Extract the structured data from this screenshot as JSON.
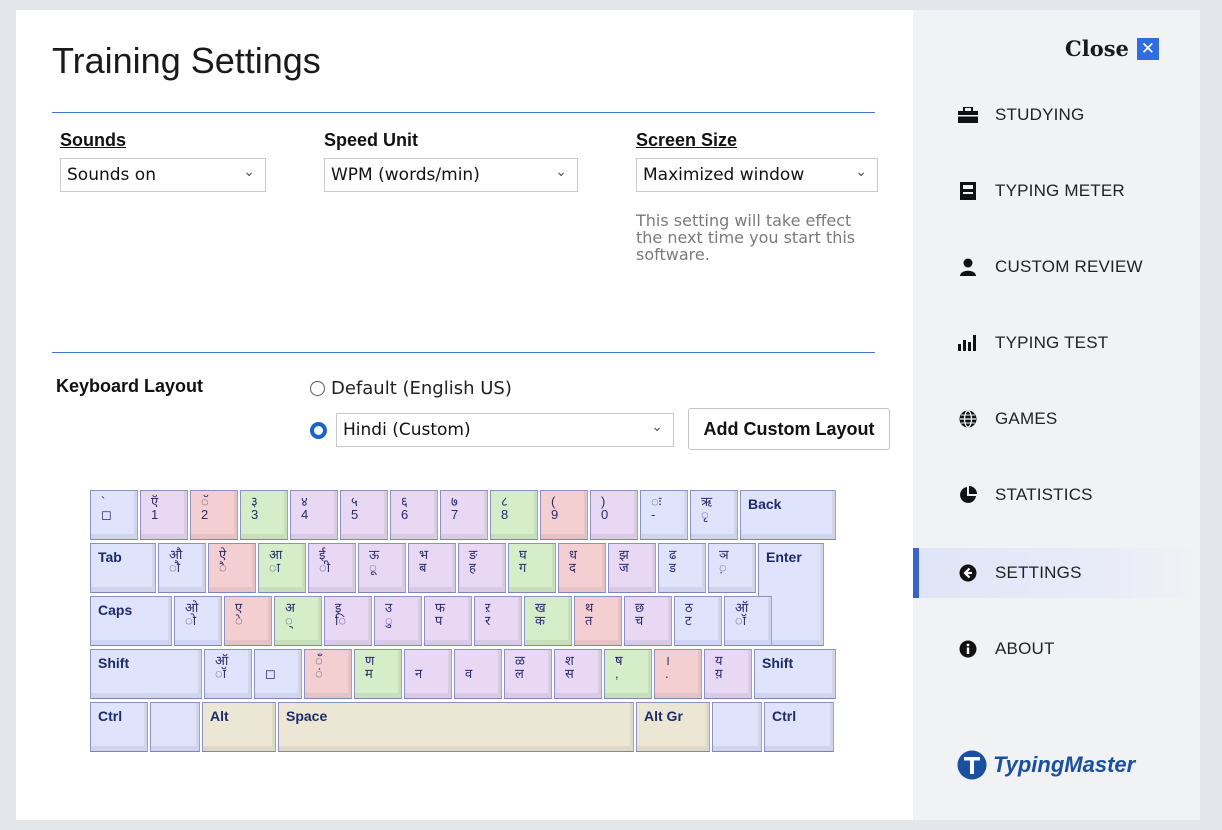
{
  "title": "Training Settings",
  "sounds": {
    "label": "Sounds",
    "value": "Sounds on"
  },
  "speed_unit": {
    "label": "Speed Unit",
    "value": "WPM (words/min)"
  },
  "screen_size": {
    "label": "Screen Size",
    "value": "Maximized window",
    "note": "This setting will take effect the next time you start this software."
  },
  "keyboard_layout": {
    "label": "Keyboard Layout",
    "option_default": "Default (English US)",
    "option_custom": "Hindi (Custom)",
    "add_button": "Add Custom Layout"
  },
  "keyboard": {
    "rows": [
      {
        "keys": [
          {
            "t": "`",
            "b": "◻",
            "c": "blue"
          },
          {
            "t": "ऍ",
            "b": "1",
            "c": "lav"
          },
          {
            "t": "ॅ",
            "b": "2",
            "c": "pink"
          },
          {
            "t": "३",
            "b": "3",
            "c": "green"
          },
          {
            "t": "४",
            "b": "4",
            "c": "lav"
          },
          {
            "t": "५",
            "b": "5",
            "c": "lav"
          },
          {
            "t": "६",
            "b": "6",
            "c": "lav"
          },
          {
            "t": "७",
            "b": "7",
            "c": "lav"
          },
          {
            "t": "८",
            "b": "8",
            "c": "green"
          },
          {
            "t": "(",
            "b": "9",
            "c": "pink"
          },
          {
            "t": ")",
            "b": "0",
            "c": "lav"
          },
          {
            "t": "ः",
            "b": "-",
            "c": "blue"
          },
          {
            "t": "ऋ",
            "b": "ृ",
            "c": "blue"
          },
          {
            "f": "Back",
            "c": "blue"
          }
        ]
      },
      {
        "keys": [
          {
            "f": "Tab",
            "c": "blue"
          },
          {
            "t": "औ",
            "b": "ौ",
            "c": "blue"
          },
          {
            "t": "ऐ",
            "b": "ै",
            "c": "pink"
          },
          {
            "t": "आ",
            "b": "ा",
            "c": "green"
          },
          {
            "t": "ई",
            "b": "ी",
            "c": "lav"
          },
          {
            "t": "ऊ",
            "b": "ू",
            "c": "lav"
          },
          {
            "t": "भ",
            "b": "ब",
            "c": "lav"
          },
          {
            "t": "ङ",
            "b": "ह",
            "c": "lav"
          },
          {
            "t": "घ",
            "b": "ग",
            "c": "green"
          },
          {
            "t": "ध",
            "b": "द",
            "c": "pink"
          },
          {
            "t": "झ",
            "b": "ज",
            "c": "lav"
          },
          {
            "t": "ढ",
            "b": "ड",
            "c": "blue"
          },
          {
            "t": "ञ",
            "b": "़",
            "c": "blue"
          },
          {
            "f": "Enter",
            "c": "blue"
          }
        ]
      },
      {
        "keys": [
          {
            "f": "Caps",
            "c": "blue"
          },
          {
            "t": "ओ",
            "b": "ो",
            "c": "blue"
          },
          {
            "t": "ए",
            "b": "े",
            "c": "pink"
          },
          {
            "t": "अ",
            "b": "्",
            "c": "green"
          },
          {
            "t": "इ",
            "b": "ि",
            "c": "lav"
          },
          {
            "t": "उ",
            "b": "ु",
            "c": "lav"
          },
          {
            "t": "फ",
            "b": "प",
            "c": "lav"
          },
          {
            "t": "ऱ",
            "b": "र",
            "c": "lav"
          },
          {
            "t": "ख",
            "b": "क",
            "c": "green"
          },
          {
            "t": "थ",
            "b": "त",
            "c": "pink"
          },
          {
            "t": "छ",
            "b": "च",
            "c": "lav"
          },
          {
            "t": "ठ",
            "b": "ट",
            "c": "blue"
          },
          {
            "t": "ऑ",
            "b": "ॉ",
            "c": "blue"
          }
        ]
      },
      {
        "keys": [
          {
            "f": "Shift",
            "c": "blue"
          },
          {
            "t": "ऑ",
            "b": "ॉ",
            "c": "blue"
          },
          {
            "t": "",
            "b": "◻",
            "c": "blue"
          },
          {
            "t": "ँ",
            "b": "ं",
            "c": "pink"
          },
          {
            "t": "ण",
            "b": "म",
            "c": "green"
          },
          {
            "t": "",
            "b": "न",
            "c": "lav"
          },
          {
            "t": "",
            "b": "व",
            "c": "lav"
          },
          {
            "t": "ळ",
            "b": "ल",
            "c": "lav"
          },
          {
            "t": "श",
            "b": "स",
            "c": "lav"
          },
          {
            "t": "ष",
            "b": ",",
            "c": "green"
          },
          {
            "t": "।",
            "b": ".",
            "c": "pink"
          },
          {
            "t": "य",
            "b": "य़",
            "c": "lav"
          },
          {
            "f": "Shift",
            "c": "blue"
          }
        ]
      },
      {
        "keys": [
          {
            "f": "Ctrl",
            "c": "blue"
          },
          {
            "f": "",
            "c": "blue"
          },
          {
            "f": "Alt",
            "c": "beige"
          },
          {
            "f": "Space",
            "c": "beige"
          },
          {
            "f": "Alt Gr",
            "c": "beige"
          },
          {
            "f": "",
            "c": "blue"
          },
          {
            "f": "Ctrl",
            "c": "blue"
          }
        ]
      }
    ]
  },
  "sidebar": {
    "close_label": "Close",
    "items": [
      {
        "label": "STUDYING",
        "icon": "briefcase-icon"
      },
      {
        "label": "TYPING METER",
        "icon": "meter-icon"
      },
      {
        "label": "CUSTOM REVIEW",
        "icon": "person-icon"
      },
      {
        "label": "TYPING TEST",
        "icon": "bar-chart-icon"
      },
      {
        "label": "GAMES",
        "icon": "globe-icon"
      },
      {
        "label": "STATISTICS",
        "icon": "pie-chart-icon"
      },
      {
        "label": "SETTINGS",
        "icon": "back-arrow-icon",
        "active": true
      },
      {
        "label": "ABOUT",
        "icon": "info-icon"
      }
    ],
    "logo_text": "TypingMaster"
  },
  "colors": {
    "accent": "#3a63c8",
    "rule": "#3b78c9",
    "logo": "#1b4fa0"
  }
}
